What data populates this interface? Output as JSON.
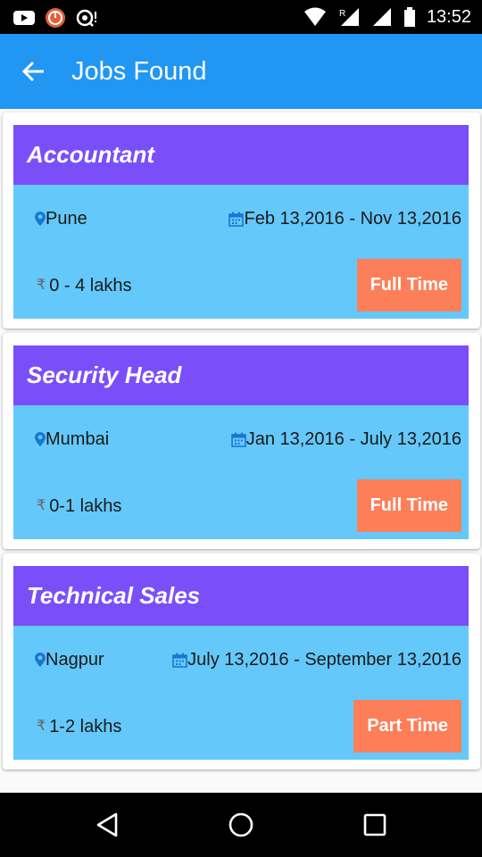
{
  "status_bar": {
    "time": "13:52",
    "icons": [
      "youtube-icon",
      "app-notification-icon",
      "hotspot-icon",
      "wifi-icon",
      "signal-roaming-icon",
      "signal-icon",
      "battery-icon"
    ]
  },
  "app_bar": {
    "title": "Jobs Found",
    "back_icon": "arrow-back-icon"
  },
  "jobs": [
    {
      "title": "Accountant",
      "location": "Pune",
      "date_range": "Feb 13,2016 - Nov 13,2016",
      "salary": "0 - 4 lakhs",
      "type": "Full Time"
    },
    {
      "title": "Security Head",
      "location": "Mumbai",
      "date_range": "Jan 13,2016 - July 13,2016",
      "salary": "0-1 lakhs",
      "type": "Full Time"
    },
    {
      "title": "Technical Sales",
      "location": "Nagpur",
      "date_range": "July 13,2016 - September 13,2016",
      "salary": "1-2 lakhs",
      "type": "Part Time"
    }
  ],
  "currency_symbol": "₹",
  "nav_bar": {
    "icons": [
      "back-triangle-icon",
      "home-circle-icon",
      "recents-square-icon"
    ]
  },
  "colors": {
    "app_bar": "#2196f3",
    "title_bar": "#7a4ffa",
    "details": "#64c8fa",
    "type_button": "#fd7f5a"
  }
}
